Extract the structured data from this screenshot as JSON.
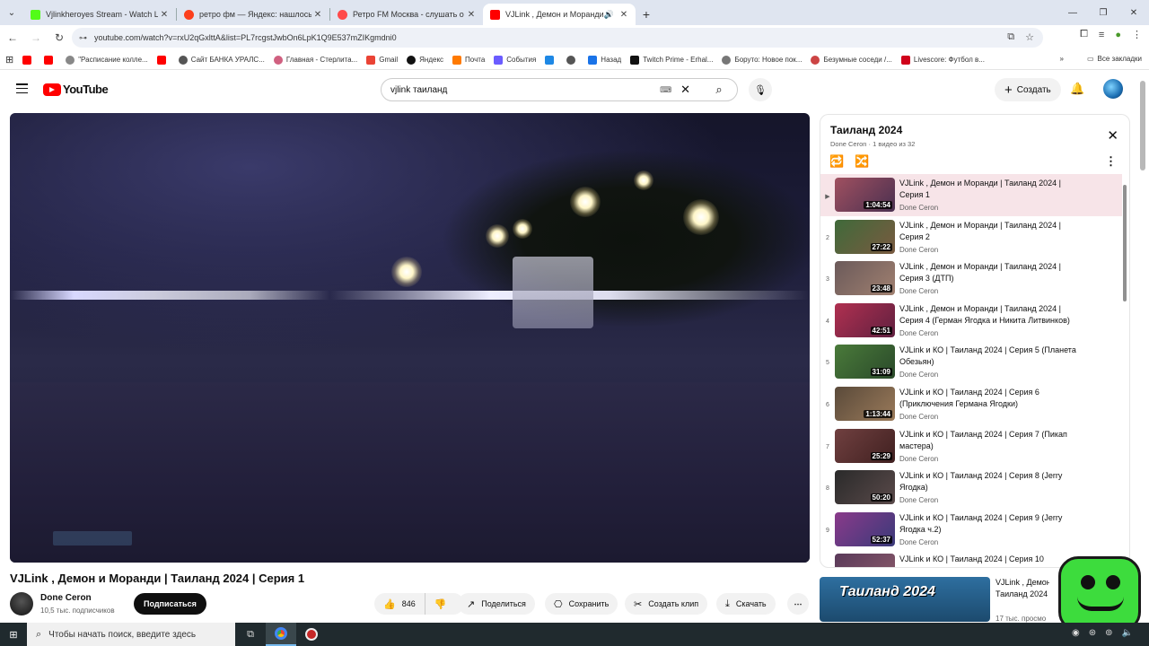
{
  "browser": {
    "tabs": [
      {
        "title": "Vjlinkheroyes Stream - Watch L",
        "fav_color": "#53fc18",
        "active": false
      },
      {
        "title": "ретро фм — Яндекс: нашлось",
        "fav_color": "#fc3f1d",
        "active": false
      },
      {
        "title": "Ретро FM Москва - слушать о",
        "fav_color": "#ff4a4a",
        "active": false
      },
      {
        "title": "VJLink , Демон и Моранди",
        "fav_color": "#ff0000",
        "active": true
      }
    ],
    "url": "youtube.com/watch?v=rxU2qGxlttA&list=PL7rcgstJwbOn6LpK1Q9E537mZIKgmdni0",
    "bookmarks": [
      {
        "label": "",
        "color": "#ff0000"
      },
      {
        "label": "",
        "color": "#ff0000"
      },
      {
        "label": "\"Расписание коллe...",
        "color": "#888888"
      },
      {
        "label": "",
        "color": "#ff0000"
      },
      {
        "label": "Сайт БАНКА УРАЛС...",
        "color": "#555555"
      },
      {
        "label": "Главная - Стерлита...",
        "color": "#d06080"
      },
      {
        "label": "Gmail",
        "color": "#ea4335"
      },
      {
        "label": "Яндекс",
        "color": "#111111"
      },
      {
        "label": "Почта",
        "color": "#ff7a00"
      },
      {
        "label": "События",
        "color": "#6b5cff"
      },
      {
        "label": "",
        "color": "#1e88e5"
      },
      {
        "label": "",
        "color": "#555555"
      },
      {
        "label": "Назад",
        "color": "#1a73e8"
      },
      {
        "label": "Twitch Prime - Erhal...",
        "color": "#111111"
      },
      {
        "label": "Боруто: Новое пок...",
        "color": "#777777"
      },
      {
        "label": "Безумные соседи /...",
        "color": "#cc4444"
      },
      {
        "label": "Livescore: Футбол в...",
        "color": "#d0021b"
      }
    ],
    "all_bookmarks": "Все закладки"
  },
  "youtube": {
    "logo": "YouTube",
    "search_query": "vjlink таиланд",
    "create_label": "Создать"
  },
  "video": {
    "title": "VJLink , Демон и Моранди | Таиланд 2024 | Серия 1",
    "channel": "Done Ceron",
    "subscribers": "10,5 тыс. подписчиков",
    "subscribe": "Подписаться",
    "likes": "846",
    "share": "Поделиться",
    "save": "Сохранить",
    "clip": "Создать клип",
    "download": "Скачать"
  },
  "playlist": {
    "title": "Таиланд 2024",
    "subtitle": "Done Ceron · 1 видео из 32",
    "items": [
      {
        "index": "▶",
        "title": "VJLink , Демон и Моранди | Таиланд 2024 | Серия 1",
        "channel": "Done Ceron",
        "duration": "1:04:54",
        "thumb": "#a05060"
      },
      {
        "index": "2",
        "title": "VJLink , Демон и Моранди | Таиланд 2024 | Серия 2",
        "channel": "Done Ceron",
        "duration": "27:22",
        "thumb": "#3f6a3a"
      },
      {
        "index": "3",
        "title": "VJLink , Демон и Моранди | Таиланд 2024 | Серия 3 (ДТП)",
        "channel": "Done Ceron",
        "duration": "23:48",
        "thumb": "#6b5a5a"
      },
      {
        "index": "4",
        "title": "VJLink , Демон и Моранди | Таиланд 2024 | Серия 4 (Герман Ягодка и Никита Литвинков)",
        "channel": "Done Ceron",
        "duration": "42:51",
        "thumb": "#b03050"
      },
      {
        "index": "5",
        "title": "VJLink и КО | Таиланд 2024 | Серия 5 (Планета Обезьян)",
        "channel": "Done Ceron",
        "duration": "31:09",
        "thumb": "#4a7a3a"
      },
      {
        "index": "6",
        "title": "VJLink и КО | Таиланд 2024 | Серия 6 (Приключения Германа Ягодки)",
        "channel": "Done Ceron",
        "duration": "1:13:44",
        "thumb": "#5a4a3a"
      },
      {
        "index": "7",
        "title": "VJLink и КО | Таиланд 2024 | Серия 7 (Пикап мастера)",
        "channel": "Done Ceron",
        "duration": "25:29",
        "thumb": "#704040"
      },
      {
        "index": "8",
        "title": "VJLink и КО | Таиланд 2024 | Серия 8 (Jerry Ягодка)",
        "channel": "Done Ceron",
        "duration": "50:20",
        "thumb": "#2a2a2a"
      },
      {
        "index": "9",
        "title": "VJLink и КО | Таиланд 2024 | Серия 9 (Jerry Ягодка ч.2)",
        "channel": "Done Ceron",
        "duration": "52:37",
        "thumb": "#8a3a8a"
      },
      {
        "index": "",
        "title": "VJLink и КО | Таиланд 2024 | Серия 10",
        "channel": "",
        "duration": "",
        "thumb": "#5a3a5a"
      }
    ]
  },
  "recommendation": {
    "thumb_text": "Таиланд 2024",
    "title": "VJLink , Демон",
    "title2": "Таиланд 2024",
    "meta": "17 тыс. просмо"
  },
  "taskbar": {
    "search_placeholder": "Чтобы начать поиск, введите здесь"
  }
}
